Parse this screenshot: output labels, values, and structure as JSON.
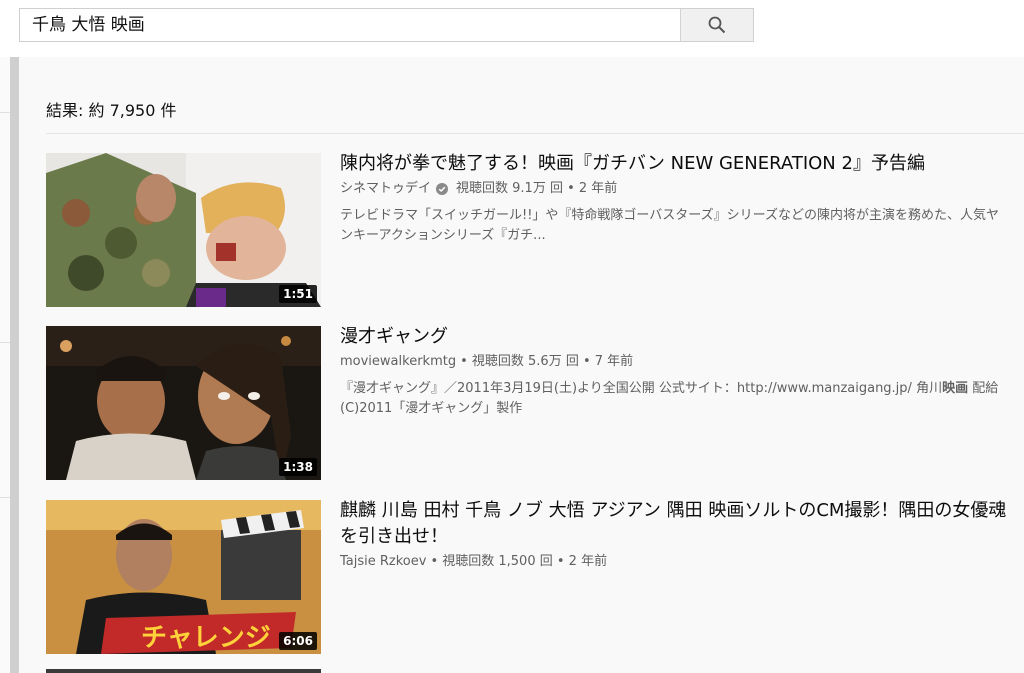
{
  "search": {
    "query": "千鳥 大悟 映画",
    "button_icon": "search-icon"
  },
  "results": {
    "count_text": "結果: 約 7,950 件"
  },
  "videos": [
    {
      "title": "陳内将が拳で魅了する！映画『ガチバン NEW GENERATION 2』予告編",
      "channel": "シネマトゥデイ",
      "verified": true,
      "stats": "視聴回数 9.1万 回 • 2 年前",
      "description": "テレビドラマ「スイッチガール!!」や『特命戦隊ゴーバスターズ』シリーズなどの陳内将が主演を務めた、人気ヤンキーアクションシリーズ『ガチ...",
      "duration": "1:51"
    },
    {
      "title": "漫才ギャング",
      "channel": "moviewalkerkmtg",
      "verified": false,
      "stats": "• 視聴回数 5.6万 回 • 7 年前",
      "description_main": "『漫才ギャング』／2011年3月19日(土)より全国公開 公式サイト：http://www.manzaigang.jp/ 角川",
      "description_bold": "映画",
      "description_tail": " 配給 (C)2011「漫才ギャング」製作",
      "duration": "1:38"
    },
    {
      "title": "麒麟 川島 田村 千鳥 ノブ 大悟 アジアン 隅田 映画ソルトのCM撮影！隅田の女優魂を引き出せ！",
      "channel": "Tajsie Rzkoev",
      "verified": false,
      "stats": "• 視聴回数 1,500 回 • 2 年前",
      "description": "",
      "duration": "6:06",
      "thumb_caption": "チャレンジ"
    }
  ],
  "colors": {
    "accent_text": "#0d0d0d",
    "meta_text": "#606060",
    "background": "#f9f9f9"
  }
}
